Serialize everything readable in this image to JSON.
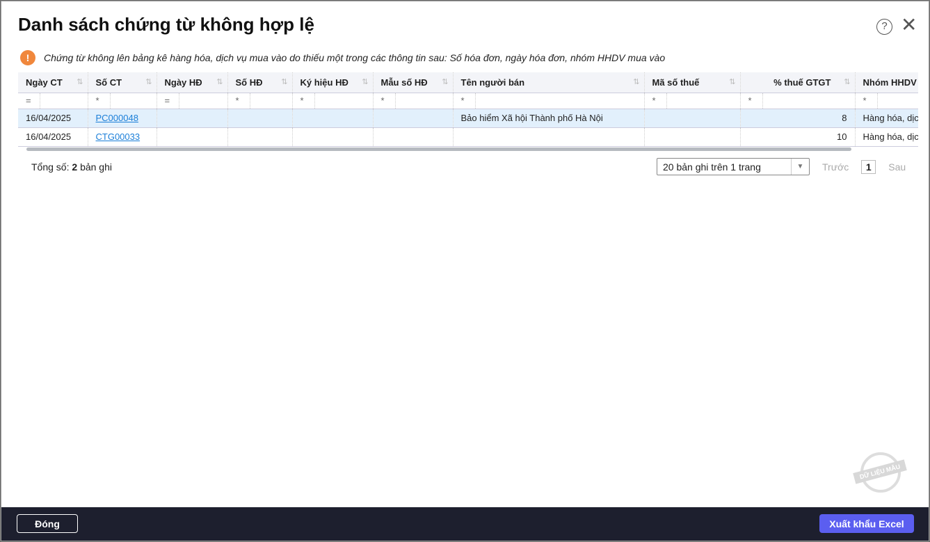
{
  "title": "Danh sách chứng từ không hợp lệ",
  "warning": "Chứng từ không lên bảng kê hàng hóa, dịch vụ mua vào do thiếu một trong các thông tin sau: Số hóa đơn, ngày hóa đơn, nhóm HHDV mua vào",
  "columns": [
    "Ngày CT",
    "Số CT",
    "Ngày HĐ",
    "Số HĐ",
    "Ký hiệu HĐ",
    "Mẫu số HĐ",
    "Tên người bán",
    "Mã số thuế",
    "% thuế GTGT",
    "Nhóm HHDV mua vào"
  ],
  "filters": [
    "=",
    "*",
    "=",
    "*",
    "*",
    "*",
    "*",
    "*",
    "*",
    "*"
  ],
  "rows": [
    {
      "ngay_ct": "16/04/2025",
      "so_ct": "PC000048",
      "ngay_hd": "",
      "so_hd": "",
      "ky_hieu": "",
      "mau_so": "",
      "ten_nguoi_ban": "Bảo hiểm Xã hội Thành phố Hà Nội",
      "mst": "",
      "thue": "8",
      "nhom": "Hàng hóa, dịch vụ"
    },
    {
      "ngay_ct": "16/04/2025",
      "so_ct": "CTG00033",
      "ngay_hd": "",
      "so_hd": "",
      "ky_hieu": "",
      "mau_so": "",
      "ten_nguoi_ban": "",
      "mst": "",
      "thue": "10",
      "nhom": "Hàng hóa, dịch vụ"
    }
  ],
  "footer": {
    "total_label": "Tổng số:",
    "total": "2",
    "total_suffix": "bản ghi",
    "page_size": "20 bản ghi trên 1 trang",
    "prev": "Trước",
    "page": "1",
    "next": "Sau"
  },
  "buttons": {
    "close": "Đóng",
    "export": "Xuất khẩu Excel"
  },
  "watermark": "DỮ LIỆU MẪU"
}
